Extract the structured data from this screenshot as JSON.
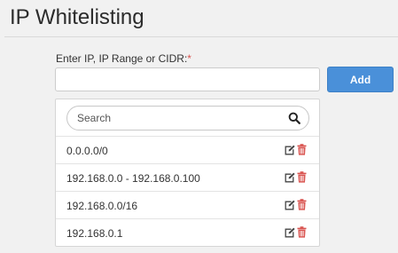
{
  "page": {
    "title": "IP Whitelisting"
  },
  "form": {
    "label": "Enter IP, IP Range or CIDR:",
    "required_marker": "*",
    "input_value": "",
    "add_label": "Add"
  },
  "search": {
    "placeholder": "Search",
    "icon": "search-icon"
  },
  "entries": [
    {
      "value": "0.0.0.0/0"
    },
    {
      "value": "192.168.0.0 - 192.168.0.100"
    },
    {
      "value": "192.168.0.0/16"
    },
    {
      "value": "192.168.0.1"
    }
  ],
  "row_actions": {
    "edit_icon": "edit-icon",
    "delete_icon": "trash-icon"
  },
  "colors": {
    "accent": "#4a90d9",
    "delete": "#d9534f",
    "required": "#d9534f"
  }
}
